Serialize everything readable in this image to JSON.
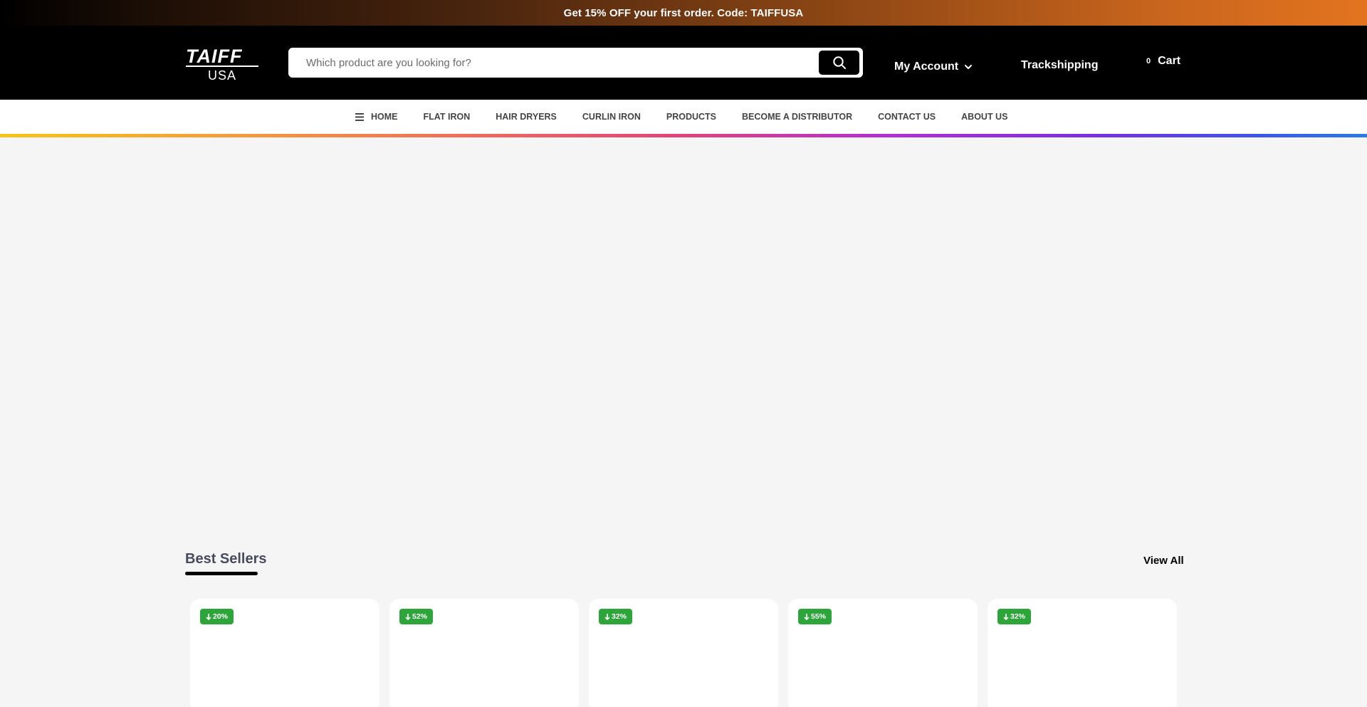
{
  "announcement": {
    "text": "Get 15% OFF your first order. Code: TAIFFUSA"
  },
  "header": {
    "logo": {
      "brand": "TAIFF",
      "sub": "USA"
    },
    "search": {
      "placeholder": "Which product are you looking for?",
      "value": "",
      "button_icon": "search-icon"
    },
    "account": {
      "label": "My Account",
      "icon": "chevron-down-icon"
    },
    "track": {
      "label": "Trackshipping"
    },
    "cart": {
      "count": "0",
      "label": "Cart"
    }
  },
  "nav": {
    "items": [
      {
        "label": "HOME",
        "icon": "menu-icon"
      },
      {
        "label": "FLAT IRON"
      },
      {
        "label": "HAIR DRYERS"
      },
      {
        "label": "CURLIN IRON"
      },
      {
        "label": "PRODUCTS"
      },
      {
        "label": "BECOME A DISTRIBUTOR"
      },
      {
        "label": "CONTACT US"
      },
      {
        "label": "ABOUT US"
      }
    ]
  },
  "best_sellers": {
    "title": "Best Sellers",
    "view_all": "View All",
    "products": [
      {
        "discount": "20%"
      },
      {
        "discount": "52%"
      },
      {
        "discount": "32%"
      },
      {
        "discount": "55%"
      },
      {
        "discount": "32%"
      }
    ]
  },
  "colors": {
    "badge_green": "#2ea53a",
    "header_black": "#000000",
    "page_background": "#f5f5f5",
    "announcement_orange": "#e3741f"
  }
}
